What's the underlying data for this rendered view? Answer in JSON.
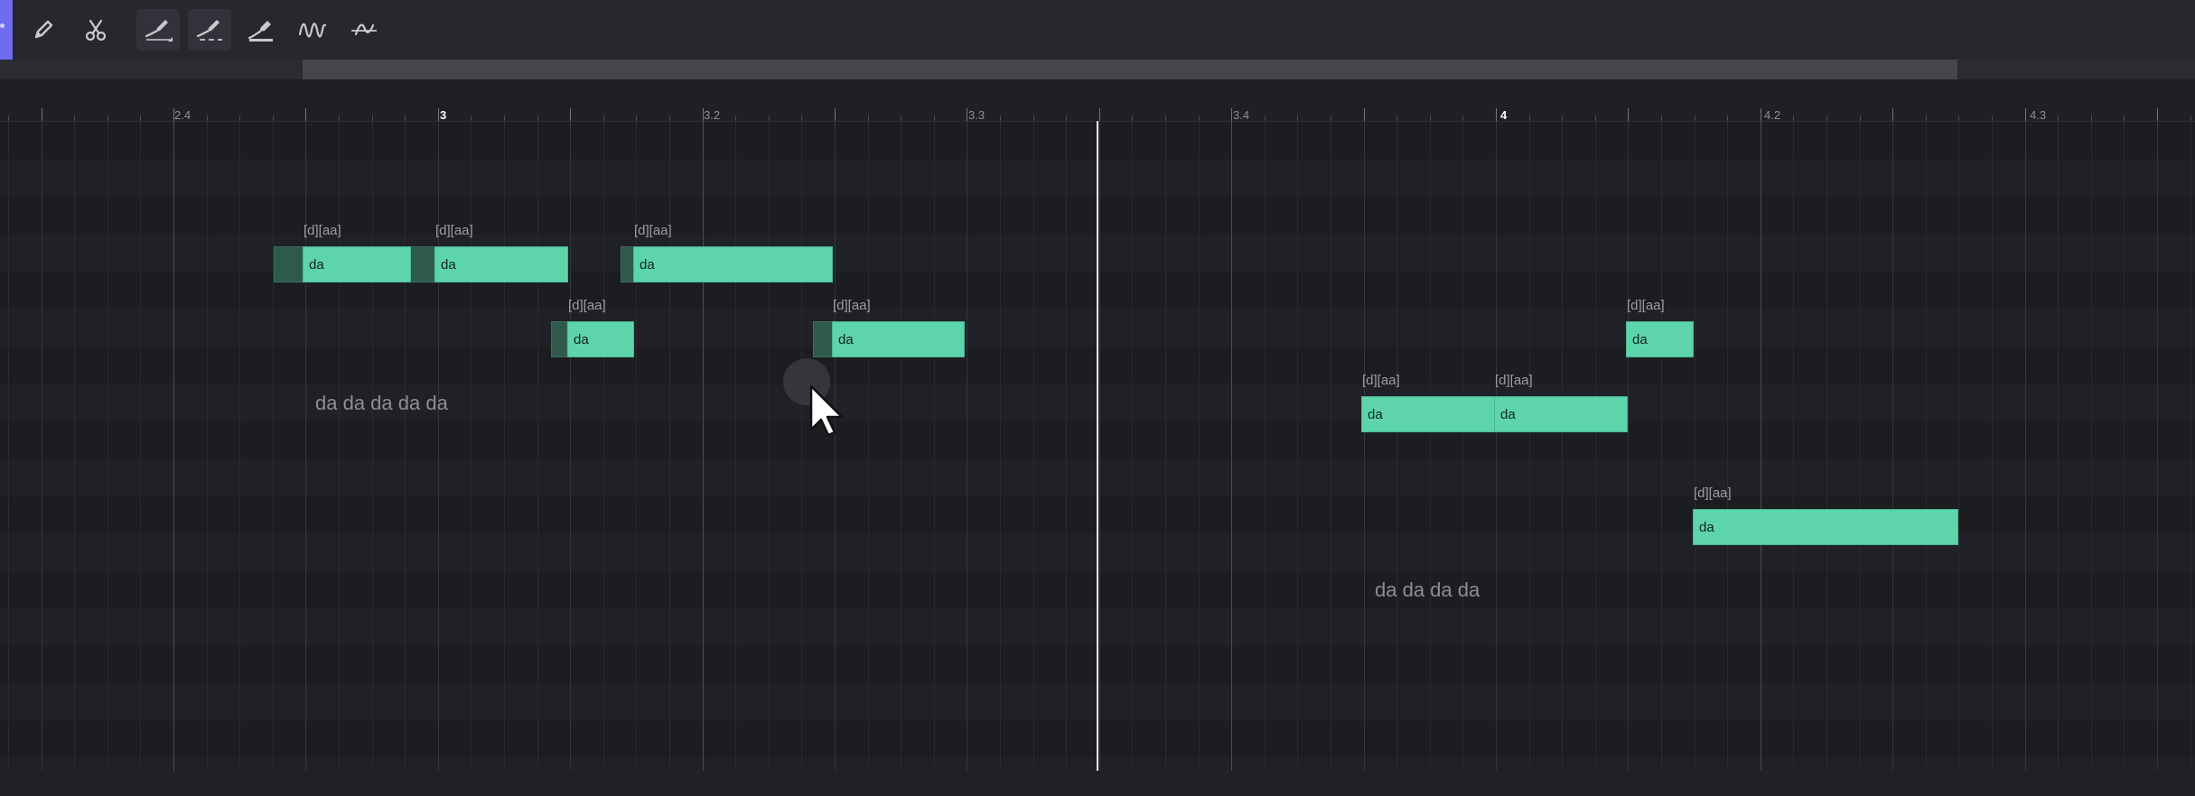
{
  "toolbar": {
    "tools": [
      {
        "icon": "pencil-icon",
        "name": "pencil-tool",
        "active": false
      },
      {
        "icon": "scissors-icon",
        "name": "cut-tool",
        "active": false
      },
      {
        "icon": "pitch-draw-icon",
        "name": "pitch-draw-tool",
        "active": true
      },
      {
        "icon": "pitch-erase-icon",
        "name": "pitch-erase-tool",
        "active": true
      },
      {
        "icon": "pitch-line-icon",
        "name": "pitch-line-tool",
        "active": false
      },
      {
        "icon": "vibrato-icon",
        "name": "vibrato-tool",
        "active": false
      },
      {
        "icon": "pitch-smooth-icon",
        "name": "pitch-smooth-tool",
        "active": false
      }
    ]
  },
  "ruler": {
    "labels": [
      "2.4",
      "3",
      "3.2",
      "3.3",
      "3.4",
      "4",
      "4.2",
      "4.3"
    ]
  },
  "notes": [
    {
      "lyric": "da",
      "phoneme": "[d][aa]"
    },
    {
      "lyric": "da",
      "phoneme": "[d][aa]"
    },
    {
      "lyric": "da",
      "phoneme": "[d][aa]"
    },
    {
      "lyric": "da",
      "phoneme": "[d][aa]"
    },
    {
      "lyric": "da",
      "phoneme": "[d][aa]"
    },
    {
      "lyric": "da",
      "phoneme": "[d][aa]"
    },
    {
      "lyric": "da",
      "phoneme": "[d][aa]"
    },
    {
      "lyric": "da",
      "phoneme": "[d][aa]"
    },
    {
      "lyric": "da",
      "phoneme": "[d][aa]"
    }
  ],
  "phrases": [
    "da da da da da",
    "da da da da"
  ],
  "colors": {
    "accent": "#6f6cf0",
    "note": "#5dd4aa",
    "background": "#1c1d21",
    "playhead": "#f2f2f2"
  }
}
